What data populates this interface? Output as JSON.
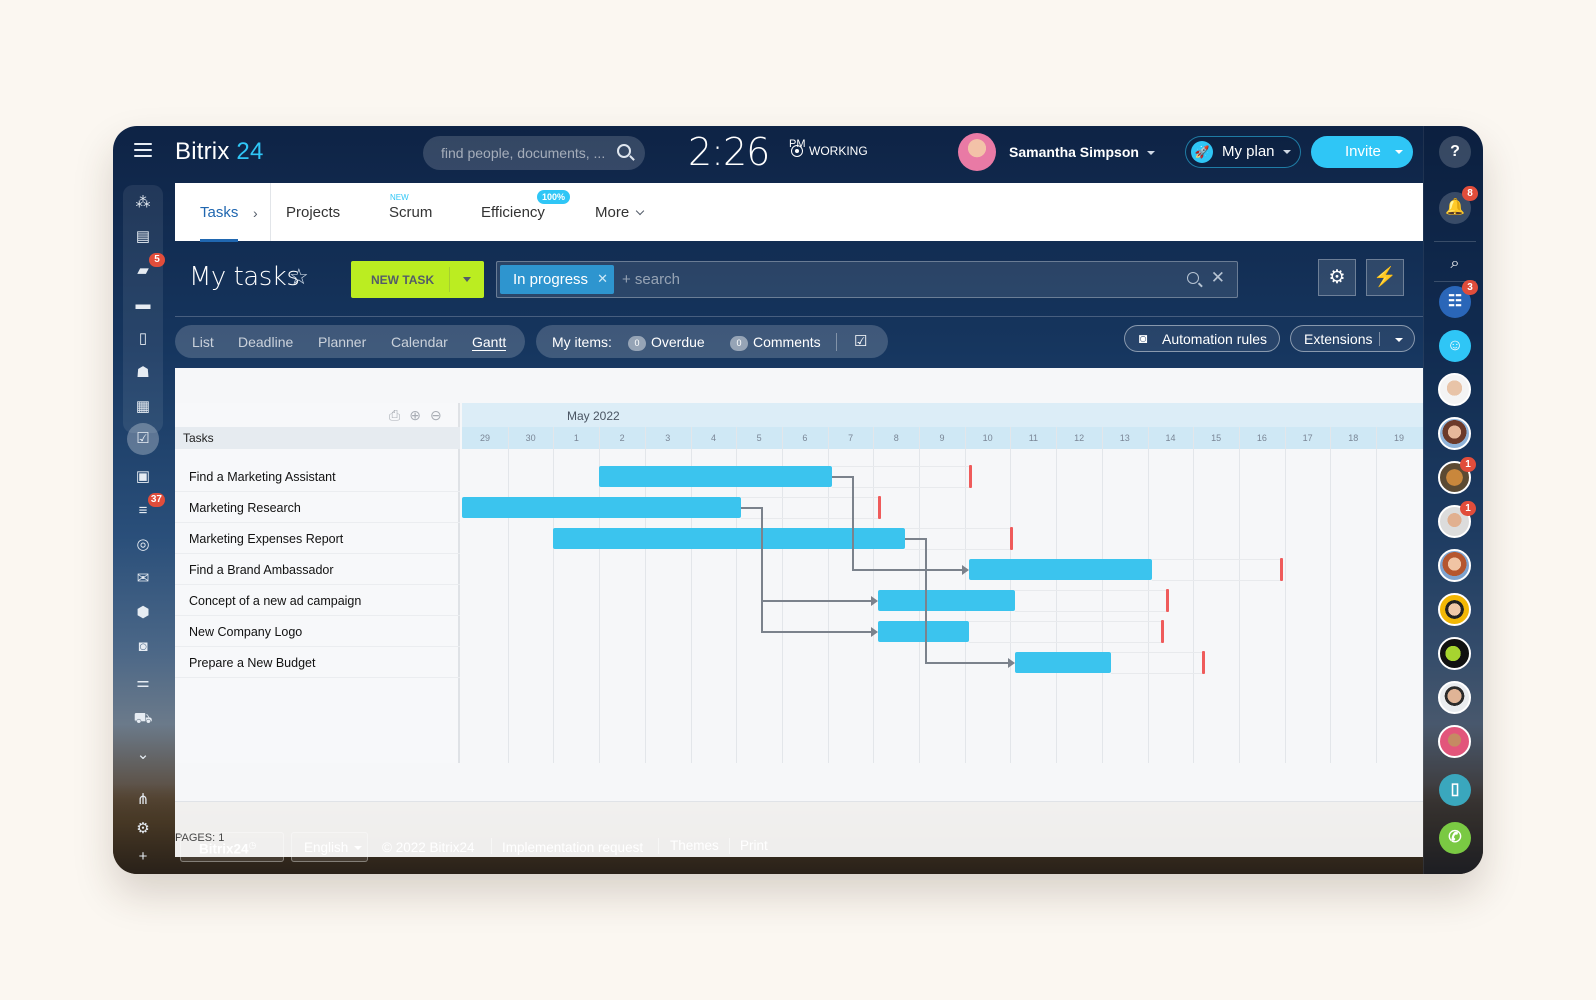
{
  "header": {
    "logo_text": "Bitrix",
    "logo_num": "24",
    "search_placeholder": "find people, documents, ...",
    "clock_time": "2:26",
    "clock_ampm": "PM",
    "status": "WORKING",
    "user_name": "Samantha Simpson",
    "plan_label": "My plan",
    "invite_label": "Invite"
  },
  "tabs": [
    {
      "label": "Tasks",
      "active": true
    },
    {
      "label": "Projects"
    },
    {
      "label": "Scrum",
      "tag": "NEW"
    },
    {
      "label": "Efficiency",
      "badge": "100%"
    },
    {
      "label": "More"
    }
  ],
  "toolbar": {
    "page_title": "My tasks",
    "new_task_label": "NEW TASK",
    "filter_chip": "In progress",
    "filter_search_placeholder": "+ search",
    "settings_icon": "gear-icon",
    "automation_icon": "lightning-icon"
  },
  "views": [
    {
      "label": "List"
    },
    {
      "label": "Deadline"
    },
    {
      "label": "Planner"
    },
    {
      "label": "Calendar"
    },
    {
      "label": "Gantt",
      "active": true
    }
  ],
  "my_items": {
    "label": "My items:",
    "overdue_count": "0",
    "overdue_label": "Overdue",
    "comments_count": "0",
    "comments_label": "Comments"
  },
  "actions": {
    "automation_rules": "Automation rules",
    "extensions": "Extensions"
  },
  "left_sidebar": [
    {
      "icon": "feed-icon"
    },
    {
      "icon": "tasks-list-icon"
    },
    {
      "icon": "chat-icon",
      "badge": "5"
    },
    {
      "icon": "drive-icon"
    },
    {
      "icon": "document-icon"
    },
    {
      "icon": "workgroups-icon"
    },
    {
      "icon": "calendar-icon"
    },
    {
      "icon": "task-check-icon",
      "active": true
    },
    {
      "icon": "contact-card-icon"
    },
    {
      "icon": "crm-funnel-icon",
      "badge": "37"
    },
    {
      "icon": "target-icon"
    },
    {
      "icon": "mail-icon"
    },
    {
      "icon": "box-icon"
    },
    {
      "icon": "robot-icon"
    },
    {
      "icon": "sliders-icon"
    },
    {
      "icon": "cart-icon"
    },
    {
      "icon": "more-chevron-icon"
    },
    {
      "icon": "sitemap-icon"
    },
    {
      "icon": "settings-icon"
    },
    {
      "icon": "plus-icon"
    }
  ],
  "right_sidebar": {
    "notifications_badge": "8",
    "group_chat_badge": "3",
    "avatars": [
      {
        "name": "contact-1"
      },
      {
        "name": "contact-2"
      },
      {
        "name": "contact-3",
        "badge": "1"
      },
      {
        "name": "contact-4",
        "badge": "1"
      },
      {
        "name": "contact-5"
      },
      {
        "name": "contact-6"
      },
      {
        "name": "contact-7"
      },
      {
        "name": "contact-8"
      },
      {
        "name": "contact-9"
      }
    ]
  },
  "gantt": {
    "tasks_header": "Tasks",
    "month_label": "May 2022",
    "pages_label": "PAGES: 1"
  },
  "chart_data": {
    "type": "gantt",
    "month": "May 2022",
    "days": [
      "29",
      "30",
      "1",
      "2",
      "3",
      "4",
      "5",
      "6",
      "7",
      "8",
      "9",
      "10",
      "11",
      "12",
      "13",
      "14",
      "15",
      "16",
      "17",
      "18",
      "19"
    ],
    "tasks": [
      {
        "name": "Find a Marketing Assistant",
        "start": 3.0,
        "end": 8.1,
        "deadline": 11.1
      },
      {
        "name": "Marketing Research",
        "start": 0.0,
        "end": 6.1,
        "deadline": 9.1
      },
      {
        "name": "Marketing Expenses Report",
        "start": 2.0,
        "end": 9.7,
        "deadline": 12.0
      },
      {
        "name": "Find a Brand Ambassador",
        "start": 11.1,
        "end": 15.1,
        "deadline": 17.9
      },
      {
        "name": "Concept of a new ad campaign",
        "start": 9.1,
        "end": 12.1,
        "deadline": 15.4
      },
      {
        "name": "New Company Logo",
        "start": 9.1,
        "end": 11.1,
        "deadline": 15.3
      },
      {
        "name": "Prepare a New Budget",
        "start": 12.1,
        "end": 14.2,
        "deadline": 16.2
      }
    ],
    "dependencies": [
      {
        "from": 0,
        "to": 3
      },
      {
        "from": 1,
        "to": 4
      },
      {
        "from": 1,
        "to": 5
      },
      {
        "from": 2,
        "to": 6
      }
    ]
  },
  "footer": {
    "brand": "Bitrix24",
    "language": "English",
    "copyright": "© 2022 Bitrix24",
    "implementation": "Implementation request",
    "themes": "Themes",
    "print": "Print"
  }
}
